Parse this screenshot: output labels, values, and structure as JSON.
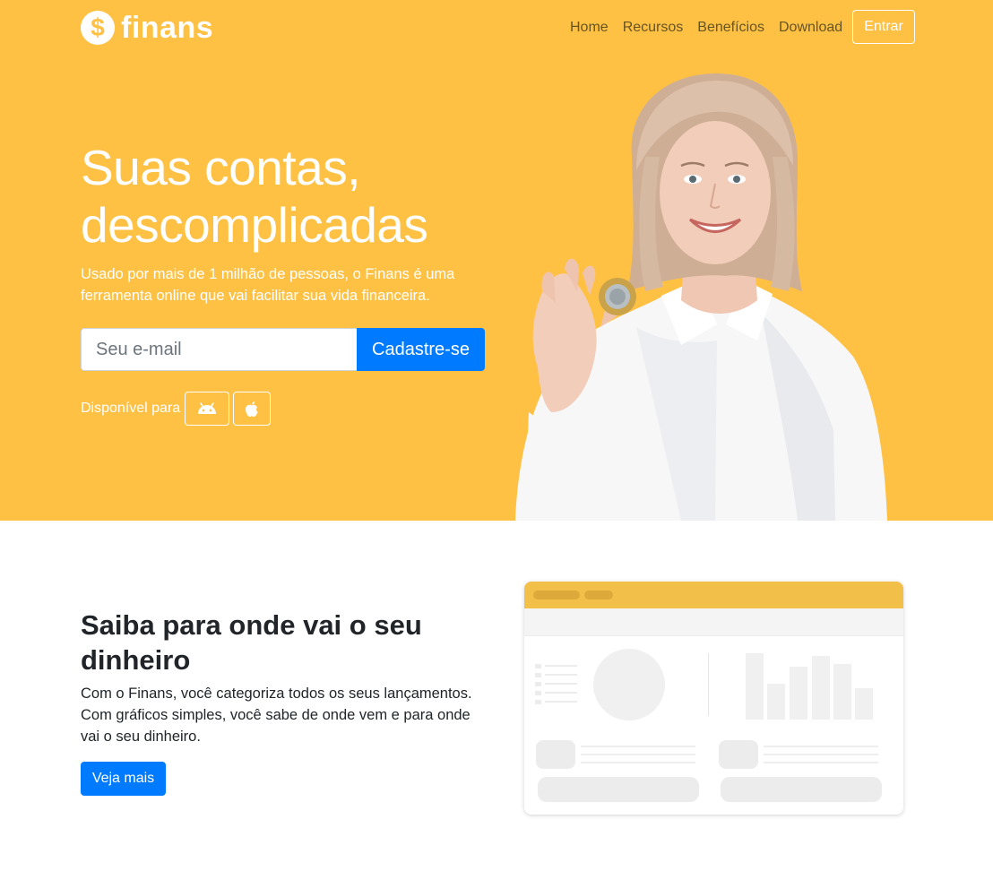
{
  "brand": {
    "name": "finans",
    "mark": "$"
  },
  "nav": {
    "links": [
      "Home",
      "Recursos",
      "Benefícios",
      "Download"
    ],
    "login_label": "Entrar"
  },
  "hero": {
    "title": "Suas contas, descomplicadas",
    "subtitle": "Usado por mais de 1 milhão de pessoas, o Finans é uma ferramenta online que vai facilitar sua vida financeira.",
    "email_placeholder": "Seu e-mail",
    "email_value": "",
    "signup_label": "Cadastre-se",
    "available_label": "Disponível para",
    "stores": [
      "android-icon",
      "apple-icon"
    ]
  },
  "feature": {
    "title": "Saiba para onde vai o seu dinheiro",
    "text": "Com o Finans, você categoriza todos os seus lançamentos. Com gráficos simples, você sabe de onde vem e para onde vai o seu dinheiro.",
    "button_label": "Veja mais"
  },
  "colors": {
    "hero_bg": "#ffc144",
    "primary": "#007bff",
    "nav_text": "#665423",
    "mockup_header": "#f2bf49",
    "mockup_placeholder": "#efefef"
  }
}
